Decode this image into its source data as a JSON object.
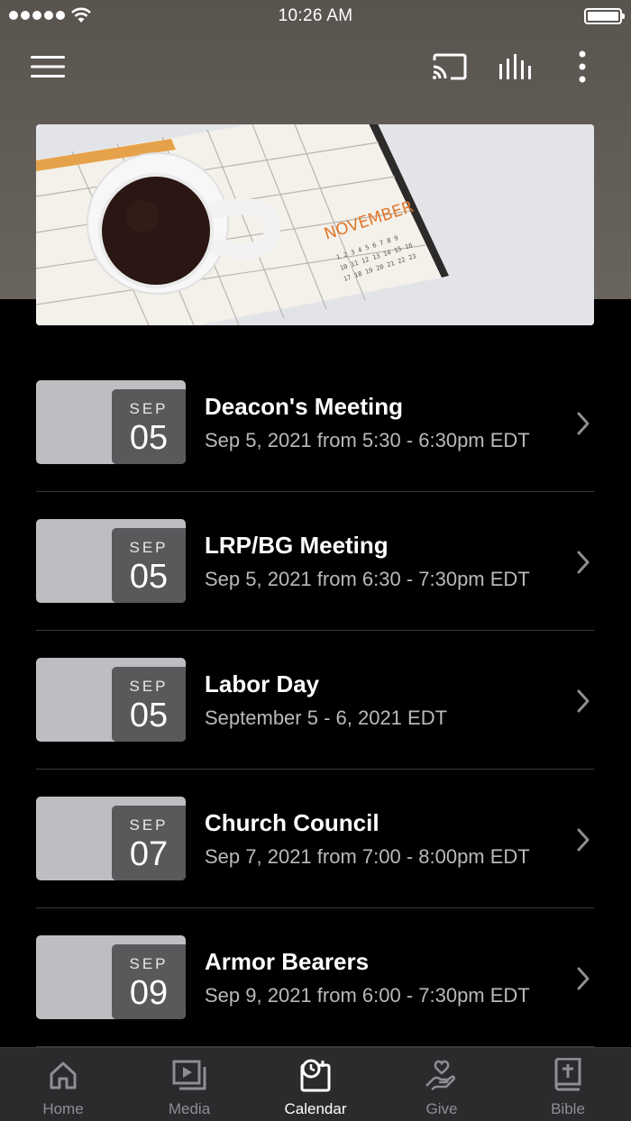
{
  "status_bar": {
    "time": "10:26 AM"
  },
  "nav": {
    "menu_icon": "hamburger-menu-icon",
    "cast_icon": "cast-icon",
    "audio_icon": "audio-bars-icon",
    "more_icon": "more-vertical-icon"
  },
  "hero": {
    "image": "coffee-cup-on-calendar-photo"
  },
  "events": [
    {
      "month": "SEP",
      "day": "05",
      "title": "Deacon's Meeting",
      "subtitle": "Sep 5, 2021 from 5:30 - 6:30pm EDT"
    },
    {
      "month": "SEP",
      "day": "05",
      "title": "LRP/BG Meeting",
      "subtitle": "Sep 5, 2021 from 6:30 - 7:30pm EDT"
    },
    {
      "month": "SEP",
      "day": "05",
      "title": "Labor Day",
      "subtitle": "September 5 - 6, 2021 EDT"
    },
    {
      "month": "SEP",
      "day": "07",
      "title": "Church Council",
      "subtitle": "Sep 7, 2021 from 7:00 - 8:00pm EDT"
    },
    {
      "month": "SEP",
      "day": "09",
      "title": "Armor Bearers",
      "subtitle": "Sep 9, 2021 from 6:00 - 7:30pm EDT"
    }
  ],
  "tabs": [
    {
      "label": "Home",
      "icon": "home-icon"
    },
    {
      "label": "Media",
      "icon": "media-play-icon"
    },
    {
      "label": "Calendar",
      "icon": "calendar-clock-icon",
      "active": true
    },
    {
      "label": "Give",
      "icon": "give-heart-hand-icon"
    },
    {
      "label": "Bible",
      "icon": "bible-cross-icon"
    }
  ],
  "colors": {
    "background": "#000000",
    "header": "#5a544f",
    "tab_bar": "#2b2b2d",
    "active_tab": "#ffffff",
    "inactive_tab": "#8e8e93"
  }
}
